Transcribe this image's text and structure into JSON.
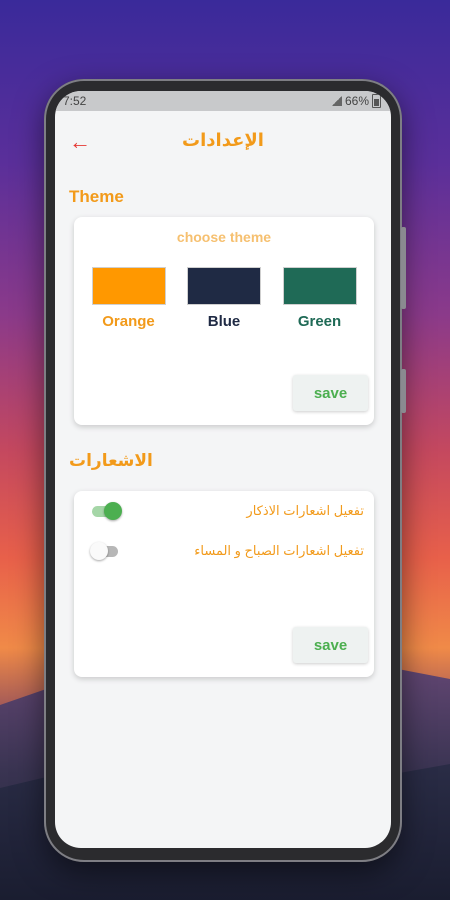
{
  "status": {
    "time": "7:52",
    "battery": "66%"
  },
  "appbar": {
    "title": "الإعدادات",
    "back_icon": "arrow-back-icon"
  },
  "theme_section": {
    "title": "Theme",
    "choose_label": "choose theme",
    "options": [
      {
        "label": "Orange",
        "color": "#ff9800",
        "text_color": "#f29a1a"
      },
      {
        "label": "Blue",
        "color": "#1f2a44",
        "text_color": "#1f2a44"
      },
      {
        "label": "Green",
        "color": "#1f6a56",
        "text_color": "#1f6a56"
      }
    ],
    "save_label": "save"
  },
  "notif_section": {
    "title": "الاشعارات",
    "items": [
      {
        "label": "تفعيل اشعارات الاذكار",
        "enabled": true
      },
      {
        "label": "تفعيل اشعارات الصباح و المساء",
        "enabled": false
      }
    ],
    "save_label": "save"
  },
  "colors": {
    "accent": "#f29a1a",
    "back_arrow": "#e53935",
    "save_text": "#4caf50"
  }
}
